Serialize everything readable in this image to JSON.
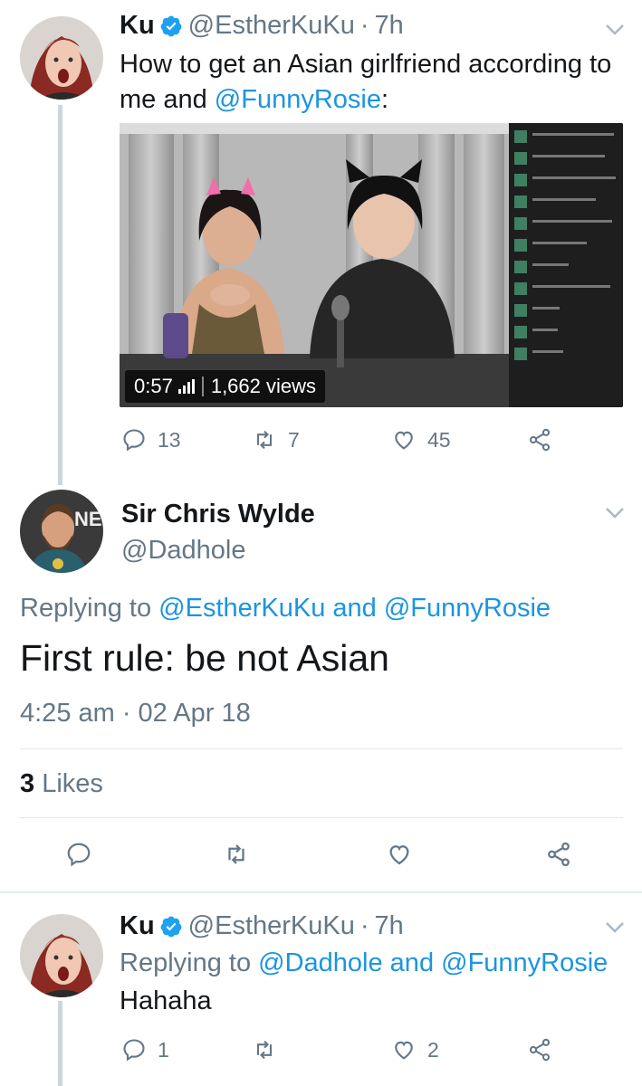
{
  "tweet1": {
    "name": "Ku",
    "handle": "@EstherKuKu",
    "time": "7h",
    "text_prefix": "How to get an Asian girlfriend according to me and ",
    "mention": "@FunnyRosie",
    "text_suffix": ":",
    "video": {
      "duration": "0:57",
      "views": "1,662 views"
    },
    "replies": "13",
    "retweets": "7",
    "likes": "45"
  },
  "tweet2": {
    "name": "Sir Chris Wylde",
    "handle": "@Dadhole",
    "replying_prefix": "Replying to ",
    "replying_user1": "@EstherKuKu",
    "replying_and": " and ",
    "replying_user2": "@FunnyRosie",
    "text": "First rule: be not Asian",
    "timestamp": "4:25 am · 02 Apr 18",
    "likes_count": "3",
    "likes_label": "Likes"
  },
  "tweet3": {
    "name": "Ku",
    "handle": "@EstherKuKu",
    "time": "7h",
    "replying_prefix": "Replying to ",
    "replying_user1": "@Dadhole",
    "replying_and": " and ",
    "replying_user2": "@FunnyRosie",
    "text": "Hahaha",
    "replies": "1",
    "retweets": "",
    "likes": "2"
  },
  "colors": {
    "accent": "#1b95e0",
    "secondary_text": "#657786",
    "verified": "#1da1f2",
    "thread_line": "#ccd6dd"
  },
  "icons": [
    "reply-icon",
    "retweet-icon",
    "like-icon",
    "share-icon",
    "verified-icon",
    "chevron-down-icon",
    "video-views-icon"
  ]
}
